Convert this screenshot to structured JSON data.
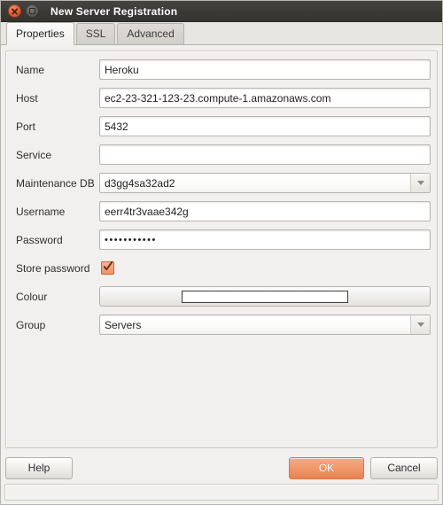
{
  "window": {
    "title": "New Server Registration",
    "close_icon": "close-icon",
    "maximize_icon": "maximize-icon",
    "accent_color": "#e8834f",
    "titlebar_color": "#3b3a36"
  },
  "tabs": [
    {
      "label": "Properties",
      "active": true
    },
    {
      "label": "SSL",
      "active": false
    },
    {
      "label": "Advanced",
      "active": false
    }
  ],
  "form": {
    "name": {
      "label": "Name",
      "value": "Heroku",
      "placeholder": ""
    },
    "host": {
      "label": "Host",
      "value": "ec2-23-321-123-23.compute-1.amazonaws.com",
      "placeholder": ""
    },
    "port": {
      "label": "Port",
      "value": "5432",
      "placeholder": ""
    },
    "service": {
      "label": "Service",
      "value": "",
      "placeholder": ""
    },
    "maintenance_db": {
      "label": "Maintenance DB",
      "value": "d3gg4sa32ad2",
      "arrow_icon": "chevron-down-icon"
    },
    "username": {
      "label": "Username",
      "value": "eerr4tr3vaae342g",
      "placeholder": ""
    },
    "password": {
      "label": "Password",
      "value": "•••••••••••",
      "placeholder": ""
    },
    "store_password": {
      "label": "Store password",
      "checked": true,
      "check_icon": "checkmark-icon"
    },
    "colour": {
      "label": "Colour",
      "swatch_color": "#ffffff"
    },
    "group": {
      "label": "Group",
      "value": "Servers",
      "arrow_icon": "chevron-down-icon"
    }
  },
  "buttons": {
    "help": "Help",
    "ok": "OK",
    "cancel": "Cancel"
  },
  "statusbar": {
    "text": ""
  }
}
